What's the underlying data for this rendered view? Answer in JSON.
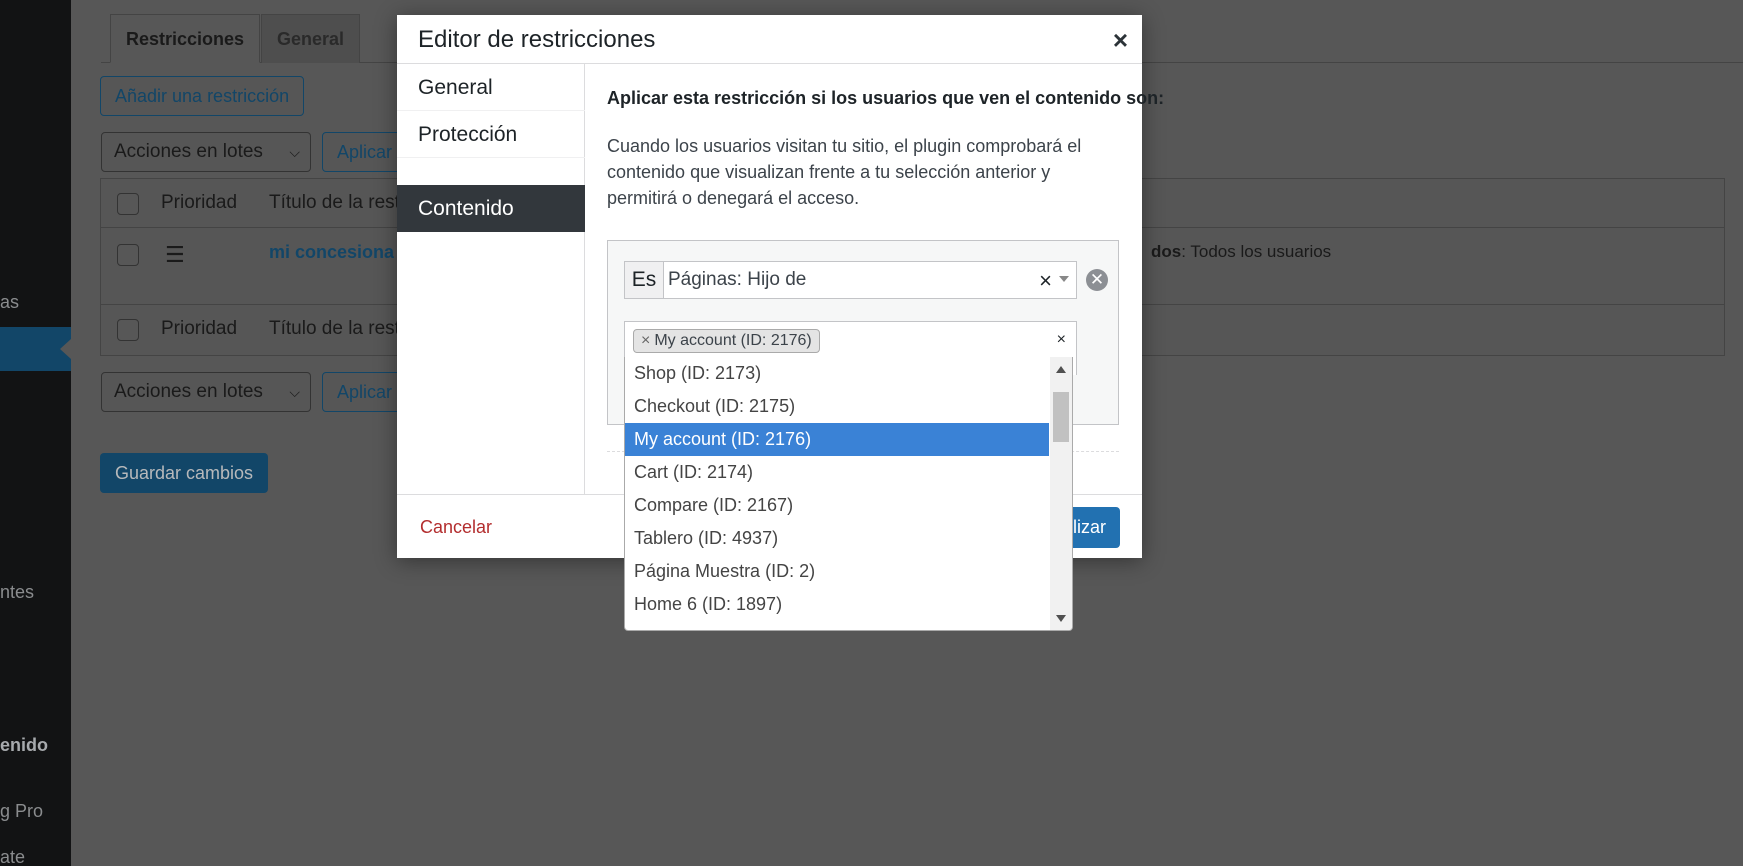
{
  "sidebar": {
    "items": [
      {
        "label": "as"
      },
      {
        "label": "ntes"
      },
      {
        "label": "enido"
      },
      {
        "label": "g Pro"
      },
      {
        "label": "ate"
      }
    ]
  },
  "page": {
    "tabs": [
      {
        "label": "Restricciones"
      },
      {
        "label": "General"
      }
    ],
    "add_button": "Añadir una restricción",
    "bulk_select": "Acciones en lotes",
    "apply_button": "Aplicar",
    "table": {
      "headers": {
        "priority": "Prioridad",
        "title": "Título de la rest"
      },
      "rows": [
        {
          "title": "mi concesionar",
          "info_bold": "dos",
          "info_text": ": Todos los usuarios"
        }
      ]
    },
    "save_button": "Guardar cambios"
  },
  "modal": {
    "title": "Editor de restricciones",
    "close": "×",
    "nav": [
      {
        "label": "General"
      },
      {
        "label": "Protección"
      },
      {
        "label": "Contenido"
      }
    ],
    "lead": "Aplicar esta restricción si los usuarios que ven el contenido son:",
    "description": "Cuando los usuarios visitan tu sitio, el plugin comprobará el contenido que visualizan frente a tu selección anterior y permitirá o denegará el acceso.",
    "rule": {
      "operator": "Es",
      "value": "Páginas: Hijo de",
      "clear": "×",
      "remove": "✕"
    },
    "selected_token": {
      "remove": "×",
      "label": "My account (ID: 2176)"
    },
    "multi_clear": "×",
    "cancel": "Cancelar",
    "update": "lizar"
  },
  "dropdown": {
    "options": [
      {
        "label": "Shop (ID: 2173)"
      },
      {
        "label": "Checkout (ID: 2175)"
      },
      {
        "label": "My account (ID: 2176)"
      },
      {
        "label": "Cart (ID: 2174)"
      },
      {
        "label": "Compare (ID: 2167)"
      },
      {
        "label": "Tablero (ID: 4937)"
      },
      {
        "label": "Página Muestra (ID: 2)"
      },
      {
        "label": "Home 6 (ID: 1897)"
      }
    ],
    "highlighted": "My account (ID: 2176)"
  },
  "colors": {
    "overlay": "#575757",
    "primary": "#2271b1",
    "highlight": "#3a82d6",
    "danger": "#b32d2e",
    "active_nav": "#32373c"
  }
}
